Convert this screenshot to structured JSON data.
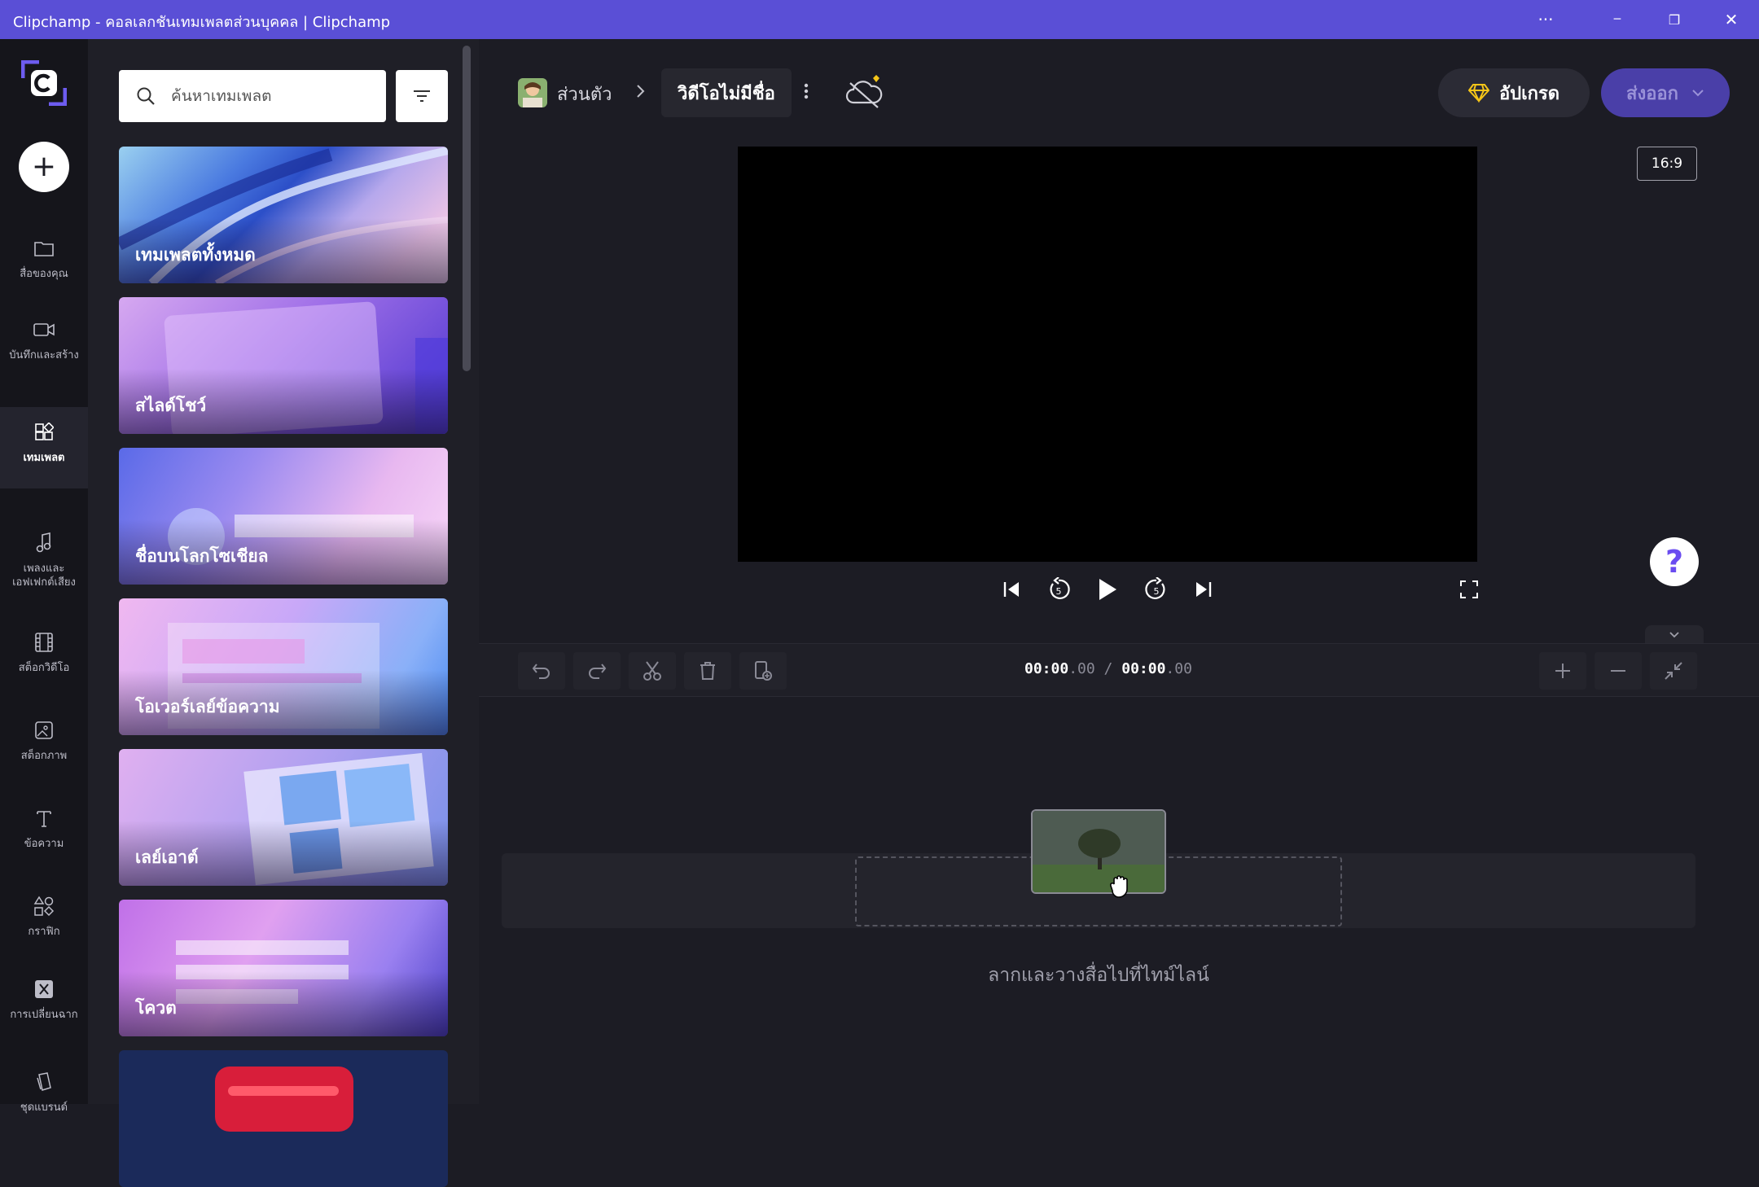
{
  "window": {
    "title": "Clipchamp - คอลเลกชันเทมเพลตส่วนบุคคล | Clipchamp",
    "more_glyph": "···",
    "minimize_glyph": "─",
    "restore_glyph": "❐",
    "close_glyph": "✕"
  },
  "rail": {
    "create_glyph": "+",
    "items": [
      {
        "label": "สื่อของคุณ",
        "icon": "folder-icon"
      },
      {
        "label": "บันทึกและสร้าง",
        "icon": "video-camera-icon"
      },
      {
        "label": "เทมเพลต",
        "icon": "templates-icon",
        "active": true
      },
      {
        "label": "เพลงและเอฟเฟกต์เสียง",
        "icon": "music-note-icon"
      },
      {
        "label": "สต็อกวิดีโอ",
        "icon": "film-icon"
      },
      {
        "label": "สต็อกภาพ",
        "icon": "image-icon"
      },
      {
        "label": "ข้อความ",
        "icon": "text-icon"
      },
      {
        "label": "กราฟิก",
        "icon": "shapes-icon"
      },
      {
        "label": "การเปลี่ยนฉาก",
        "icon": "transition-icon"
      },
      {
        "label": "ชุดแบรนด์",
        "icon": "brand-kit-icon"
      }
    ]
  },
  "panel": {
    "search_placeholder": "ค้นหาเทมเพลต",
    "cards": [
      {
        "label": "เทมเพลตทั้งหมด"
      },
      {
        "label": "สไลด์โชว์"
      },
      {
        "label": "ชื่อบนโลกโซเชียล"
      },
      {
        "label": "โอเวอร์เลย์ข้อความ"
      },
      {
        "label": "เลย์เอาต์"
      },
      {
        "label": "โควต"
      },
      {
        "label": ""
      }
    ]
  },
  "header": {
    "workspace": "ส่วนตัว",
    "project_name": "วิดีโอไม่มีชื่อ",
    "upgrade_label": "อัปเกรด",
    "export_label": "ส่งออก"
  },
  "preview": {
    "aspect_ratio": "16:9",
    "help_glyph": "?"
  },
  "timeline": {
    "current_time": "00:00",
    "current_frac": ".00",
    "separator": "/",
    "total_time": "00:00",
    "total_frac": ".00",
    "drop_hint": "ลากและวางสื่อไปที่ไทม์ไลน์"
  },
  "colors": {
    "titlebar": "#5a4fd6",
    "accent": "#6a4cf0",
    "upgrade_icon": "#f5c518"
  }
}
